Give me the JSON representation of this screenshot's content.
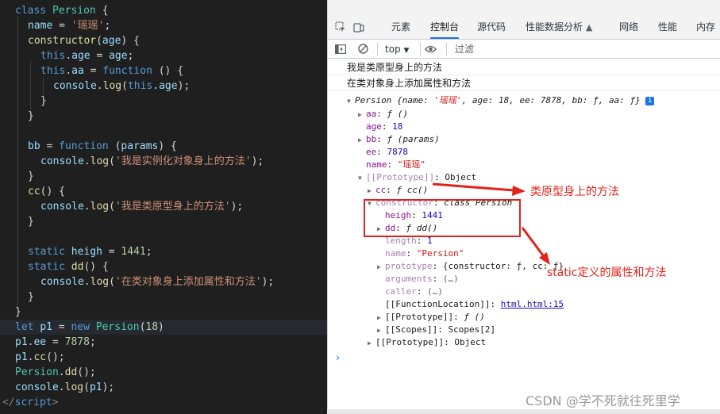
{
  "editor": {
    "lines": [
      {
        "tokens": [
          [
            "kw",
            "class "
          ],
          [
            "cls",
            "Persion"
          ],
          [
            "p",
            " {"
          ]
        ]
      },
      {
        "tokens": [
          [
            "prop",
            "name"
          ],
          [
            "p",
            " = "
          ],
          [
            "str",
            "'瑶瑶'"
          ],
          [
            "p",
            ";"
          ]
        ]
      },
      {
        "tokens": [
          [
            "fn",
            "constructor"
          ],
          [
            "p",
            "("
          ],
          [
            "prop",
            "age"
          ],
          [
            "p",
            ") {"
          ]
        ]
      },
      {
        "tokens": [
          [
            "kw",
            "this"
          ],
          [
            "p",
            "."
          ],
          [
            "prop",
            "age"
          ],
          [
            "p",
            " = "
          ],
          [
            "prop",
            "age"
          ],
          [
            "p",
            ";"
          ]
        ]
      },
      {
        "tokens": [
          [
            "kw",
            "this"
          ],
          [
            "p",
            "."
          ],
          [
            "prop",
            "aa"
          ],
          [
            "p",
            " = "
          ],
          [
            "kw",
            "function"
          ],
          [
            "p",
            " () {"
          ]
        ]
      },
      {
        "tokens": [
          [
            "prop",
            "console"
          ],
          [
            "p",
            "."
          ],
          [
            "fn",
            "log"
          ],
          [
            "p",
            "("
          ],
          [
            "kw",
            "this"
          ],
          [
            "p",
            "."
          ],
          [
            "prop",
            "age"
          ],
          [
            "p",
            ");"
          ]
        ]
      },
      {
        "tokens": [
          [
            "p",
            "}"
          ]
        ]
      },
      {
        "tokens": [
          [
            "p",
            "}"
          ]
        ]
      },
      {
        "tokens": []
      },
      {
        "tokens": [
          [
            "prop",
            "bb"
          ],
          [
            "p",
            " = "
          ],
          [
            "kw",
            "function"
          ],
          [
            "p",
            " ("
          ],
          [
            "prop",
            "params"
          ],
          [
            "p",
            ") {"
          ]
        ]
      },
      {
        "tokens": [
          [
            "prop",
            "console"
          ],
          [
            "p",
            "."
          ],
          [
            "fn",
            "log"
          ],
          [
            "p",
            "("
          ],
          [
            "str",
            "'我是实例化对象身上的方法'"
          ],
          [
            "p",
            ");"
          ]
        ]
      },
      {
        "tokens": [
          [
            "p",
            "}"
          ]
        ]
      },
      {
        "tokens": [
          [
            "fn",
            "cc"
          ],
          [
            "p",
            "() {"
          ]
        ]
      },
      {
        "tokens": [
          [
            "prop",
            "console"
          ],
          [
            "p",
            "."
          ],
          [
            "fn",
            "log"
          ],
          [
            "p",
            "("
          ],
          [
            "str",
            "'我是类原型身上的方法'"
          ],
          [
            "p",
            ");"
          ]
        ]
      },
      {
        "tokens": [
          [
            "p",
            "}"
          ]
        ]
      },
      {
        "tokens": []
      },
      {
        "tokens": [
          [
            "kw",
            "static "
          ],
          [
            "prop",
            "heigh"
          ],
          [
            "p",
            " = "
          ],
          [
            "num",
            "1441"
          ],
          [
            "p",
            ";"
          ]
        ]
      },
      {
        "tokens": [
          [
            "kw",
            "static "
          ],
          [
            "fn",
            "dd"
          ],
          [
            "p",
            "() {"
          ]
        ]
      },
      {
        "tokens": [
          [
            "prop",
            "console"
          ],
          [
            "p",
            "."
          ],
          [
            "fn",
            "log"
          ],
          [
            "p",
            "("
          ],
          [
            "str",
            "'在类对象身上添加属性和方法'"
          ],
          [
            "p",
            ");"
          ]
        ]
      },
      {
        "tokens": [
          [
            "p",
            "}"
          ]
        ]
      },
      {
        "tokens": [
          [
            "p",
            "}"
          ]
        ]
      },
      {
        "tokens": [
          [
            "kw",
            "let "
          ],
          [
            "prop",
            "p1"
          ],
          [
            "p",
            " = "
          ],
          [
            "kw",
            "new "
          ],
          [
            "cls",
            "Persion"
          ],
          [
            "p",
            "("
          ],
          [
            "num",
            "18"
          ],
          [
            "p",
            ")"
          ]
        ]
      },
      {
        "tokens": [
          [
            "prop",
            "p1"
          ],
          [
            "p",
            "."
          ],
          [
            "prop",
            "ee"
          ],
          [
            "p",
            " = "
          ],
          [
            "num",
            "7878"
          ],
          [
            "p",
            ";"
          ]
        ]
      },
      {
        "tokens": [
          [
            "prop",
            "p1"
          ],
          [
            "p",
            "."
          ],
          [
            "fn",
            "cc"
          ],
          [
            "p",
            "();"
          ]
        ]
      },
      {
        "tokens": [
          [
            "cls",
            "Persion"
          ],
          [
            "p",
            "."
          ],
          [
            "fn",
            "dd"
          ],
          [
            "p",
            "();"
          ]
        ]
      },
      {
        "tokens": [
          [
            "prop",
            "console"
          ],
          [
            "p",
            "."
          ],
          [
            "fn",
            "log"
          ],
          [
            "p",
            "("
          ],
          [
            "prop",
            "p1"
          ],
          [
            "p",
            ");"
          ]
        ]
      },
      {
        "tokens": [
          [
            "tag",
            "</"
          ],
          [
            "tagn",
            "script"
          ],
          [
            "tag",
            ">"
          ]
        ]
      }
    ]
  },
  "devtools": {
    "tabs": [
      {
        "label": "元素",
        "active": false
      },
      {
        "label": "控制台",
        "active": true
      },
      {
        "label": "源代码",
        "active": false
      },
      {
        "label": "性能数据分析",
        "active": false
      },
      {
        "label": "网络",
        "active": false
      },
      {
        "label": "性能",
        "active": false
      },
      {
        "label": "内存",
        "active": false
      }
    ],
    "toolbar": {
      "context": "top",
      "filter_placeholder": "过滤"
    },
    "icons": {
      "inspect": "inspect-icon",
      "device": "device-toggle-icon",
      "sidebar": "sidebar-icon",
      "clear": "clear-console-icon",
      "eye": "eye-icon",
      "flask": "flask-icon"
    },
    "messages": [
      "我是类原型身上的方法",
      "在类对象身上添加属性和方法"
    ],
    "object": {
      "header_name": "Persion",
      "header_preview": " {name: ",
      "header_name_val": "'瑶瑶'",
      "header_rest": ", age: 18, ee: 7878, bb: ƒ, aa: ƒ}",
      "info": "i",
      "aa_key": "aa",
      "aa_val": "ƒ ()",
      "age_key": "age",
      "age_val": "18",
      "bb_key": "bb",
      "bb_val": "ƒ (params)",
      "ee_key": "ee",
      "ee_val": "7878",
      "name_key": "name",
      "name_val": "\"瑶瑶\"",
      "proto_key": "[[Prototype]]",
      "proto_val": "Object",
      "cc_key": "cc",
      "cc_val": "ƒ cc()",
      "ctor_key": "constructor",
      "ctor_val": "class Persion",
      "heigh_key": "heigh",
      "heigh_val": "1441",
      "dd_key": "dd",
      "dd_val": "ƒ dd()",
      "length_key": "length",
      "length_val": "1",
      "fname_key": "name",
      "fname_val": "\"Persion\"",
      "prototype_key": "prototype",
      "prototype_val": "{constructor: ƒ, cc: ƒ}",
      "arguments_key": "arguments",
      "arguments_val": "(…)",
      "caller_key": "caller",
      "caller_val": "(…)",
      "fnloc_key": "[[FunctionLocation]]",
      "fnloc_val": "html.html:15",
      "fproto_key": "[[Prototype]]",
      "fproto_val": "ƒ ()",
      "scopes_key": "[[Scopes]]",
      "scopes_val": "Scopes[2]",
      "oproto_key": "[[Prototype]]",
      "oproto_val": "Object"
    },
    "prompt": "›"
  },
  "annotations": {
    "label1": "类原型身上的方法",
    "label2": "static定义的属性和方法",
    "color": "#e0241b"
  },
  "watermark": "CSDN @学不死就往死里学"
}
